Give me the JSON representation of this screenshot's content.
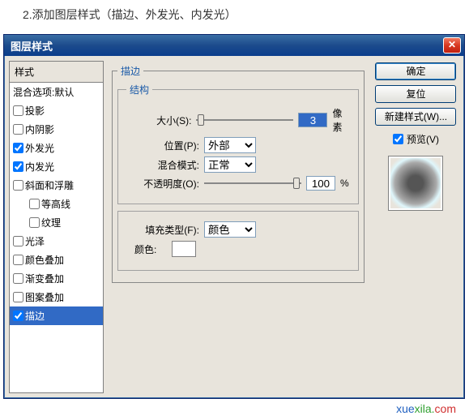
{
  "instruction": "2.添加图层样式（描边、外发光、内发光）",
  "dialog": {
    "title": "图层样式"
  },
  "styles_panel": {
    "header": "样式",
    "blending": "混合选项:默认",
    "items": [
      {
        "label": "投影",
        "checked": false,
        "selected": false
      },
      {
        "label": "内阴影",
        "checked": false,
        "selected": false
      },
      {
        "label": "外发光",
        "checked": true,
        "selected": false
      },
      {
        "label": "内发光",
        "checked": true,
        "selected": false
      },
      {
        "label": "斜面和浮雕",
        "checked": false,
        "selected": false
      },
      {
        "label": "等高线",
        "checked": false,
        "selected": false,
        "sub": true
      },
      {
        "label": "纹理",
        "checked": false,
        "selected": false,
        "sub": true
      },
      {
        "label": "光泽",
        "checked": false,
        "selected": false
      },
      {
        "label": "颜色叠加",
        "checked": false,
        "selected": false
      },
      {
        "label": "渐变叠加",
        "checked": false,
        "selected": false
      },
      {
        "label": "图案叠加",
        "checked": false,
        "selected": false
      },
      {
        "label": "描边",
        "checked": true,
        "selected": true
      }
    ]
  },
  "stroke": {
    "group_label": "描边",
    "structure_label": "结构",
    "size_label": "大小(S):",
    "size_value": "3",
    "size_unit": "像素",
    "position_label": "位置(P):",
    "position_value": "外部",
    "blend_label": "混合模式:",
    "blend_value": "正常",
    "opacity_label": "不透明度(O):",
    "opacity_value": "100",
    "opacity_unit": "%",
    "fill_type_label": "填充类型(F):",
    "fill_type_value": "颜色",
    "color_label": "颜色:",
    "color_value": "#ffffff"
  },
  "buttons": {
    "ok": "确定",
    "reset": "复位",
    "new_style": "新建样式(W)...",
    "preview": "预览(V)"
  },
  "watermark": {
    "p1": "xue",
    "p2": "xila.",
    "p3": "com"
  }
}
